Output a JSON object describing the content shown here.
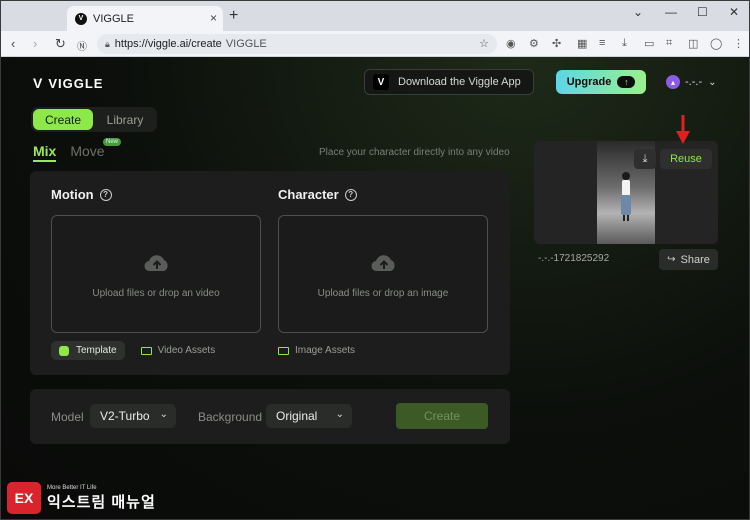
{
  "browser": {
    "tab_title": "VIGGLE",
    "tab_close": "×",
    "new_tab": "+",
    "url": "https://viggle.ai/create",
    "site_label": "VIGGLE"
  },
  "header": {
    "logo": "VIGGLE",
    "download_app": "Download the Viggle App",
    "upgrade": "Upgrade",
    "user_name": "-.-.-"
  },
  "nav": {
    "create": "Create",
    "library": "Library"
  },
  "modes": {
    "mix": "Mix",
    "move": "Move",
    "new_badge": "New",
    "hint": "Place your character directly into any video"
  },
  "motion": {
    "title": "Motion",
    "drop_text": "Upload files or drop an video",
    "template": "Template",
    "assets": "Video Assets"
  },
  "character": {
    "title": "Character",
    "drop_text": "Upload files or drop an image",
    "assets": "Image Assets"
  },
  "settings": {
    "model_label": "Model",
    "model_value": "V2-Turbo",
    "background_label": "Background",
    "background_value": "Original",
    "create": "Create"
  },
  "result": {
    "reuse": "Reuse",
    "name": "-.-.-1721825292",
    "share": "Share"
  },
  "watermark": {
    "logo_text": "EX",
    "tagline": "More Better IT Life",
    "brand": "익스트림 매뉴얼"
  },
  "colors": {
    "accent": "#8ee84a",
    "panel": "#1c1d1c",
    "callout_arrow": "#e02020"
  }
}
